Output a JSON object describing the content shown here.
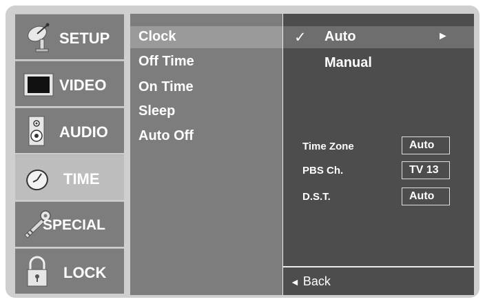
{
  "sidebar": {
    "items": [
      {
        "label": "SETUP",
        "icon": "satellite-dish-icon"
      },
      {
        "label": "VIDEO",
        "icon": "monitor-icon"
      },
      {
        "label": "AUDIO",
        "icon": "speaker-icon"
      },
      {
        "label": "TIME",
        "icon": "clock-icon"
      },
      {
        "label": "SPECIAL",
        "icon": "key-icon"
      },
      {
        "label": "LOCK",
        "icon": "padlock-icon"
      }
    ],
    "active": "TIME"
  },
  "submenu": {
    "items": [
      "Clock",
      "Off Time",
      "On Time",
      "Sleep",
      "Auto Off"
    ],
    "selected": "Clock"
  },
  "options": {
    "check_mark": "✓",
    "items": [
      "Auto",
      "Manual"
    ],
    "selected": "Auto",
    "arrow": "►"
  },
  "settings": [
    {
      "label": "Time Zone",
      "value": "Auto"
    },
    {
      "label": "PBS Ch.",
      "value": "TV 13"
    },
    {
      "label": "D.S.T.",
      "value": "Auto"
    }
  ],
  "back": {
    "arrow": "◄",
    "label": "Back"
  },
  "colors": {
    "frame": "#cfcfcf",
    "sidebar_item": "#7d7d7d",
    "sidebar_active": "#bdbdbd",
    "submenu_bg": "#7d7d7d",
    "options_bg": "#4d4d4d",
    "text": "#ffffff"
  }
}
